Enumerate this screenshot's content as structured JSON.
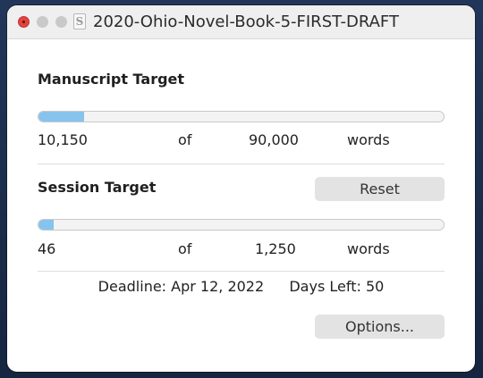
{
  "window": {
    "title": "2020-Ohio-Novel-Book-5-FIRST-DRAFT",
    "doc_icon_glyph": "S"
  },
  "manuscript": {
    "heading": "Manuscript Target",
    "current": "10,150",
    "of_label": "of",
    "target": "90,000",
    "unit": "words",
    "progress_fraction": 0.113
  },
  "session": {
    "heading": "Session Target",
    "reset_label": "Reset",
    "current": "46",
    "of_label": "of",
    "target": "1,250",
    "unit": "words",
    "progress_fraction": 0.037
  },
  "deadline": {
    "deadline_text": "Deadline: Apr 12, 2022",
    "days_left_text": "Days Left: 50"
  },
  "footer": {
    "options_label": "Options..."
  },
  "colors": {
    "progress_fill": "#86c3ee",
    "close_light": "#e0443e"
  },
  "icons": {
    "close": "close-traffic-light",
    "minimize": "minimize-traffic-light",
    "maximize": "maximize-traffic-light",
    "document": "scrivener-document-icon"
  }
}
